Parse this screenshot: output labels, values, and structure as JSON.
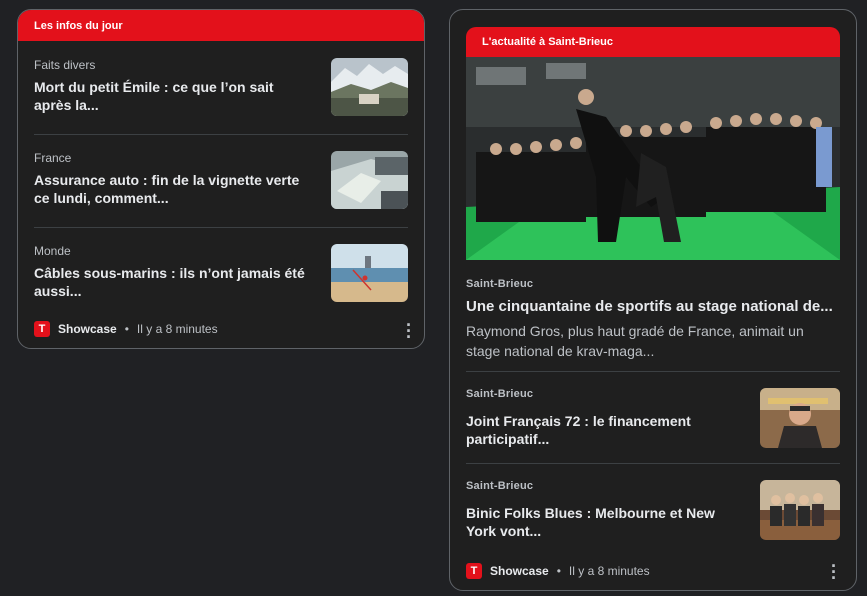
{
  "left_card": {
    "header": "Les infos du jour",
    "items": [
      {
        "category": "Faits divers",
        "title": "Mort du petit Émile : ce que l’on sait après la..."
      },
      {
        "category": "France",
        "title": "Assurance auto : fin de la vignette verte ce lundi, comment..."
      },
      {
        "category": "Monde",
        "title": "Câbles sous-marins : ils n’ont jamais été aussi..."
      }
    ],
    "footer": {
      "source": "Showcase",
      "time": "Il y a 8 minutes",
      "logo_letter": "T"
    }
  },
  "right_card": {
    "header": "L'actualité à Saint-Brieuc",
    "hero": {
      "category": "Saint-Brieuc",
      "title": "Une cinquantaine de sportifs au stage national de...",
      "snippet": "Raymond Gros, plus haut gradé de France, animait un stage national de krav-maga..."
    },
    "items": [
      {
        "category": "Saint-Brieuc",
        "title": "Joint Français 72 : le financement participatif..."
      },
      {
        "category": "Saint-Brieuc",
        "title": "Binic Folks Blues : Melbourne et New York vont..."
      }
    ],
    "footer": {
      "source": "Showcase",
      "time": "Il y a 8 minutes",
      "logo_letter": "T"
    }
  },
  "colors": {
    "accent": "#e3111b",
    "card_bg": "#1f1f1f",
    "page_bg": "#202124"
  }
}
